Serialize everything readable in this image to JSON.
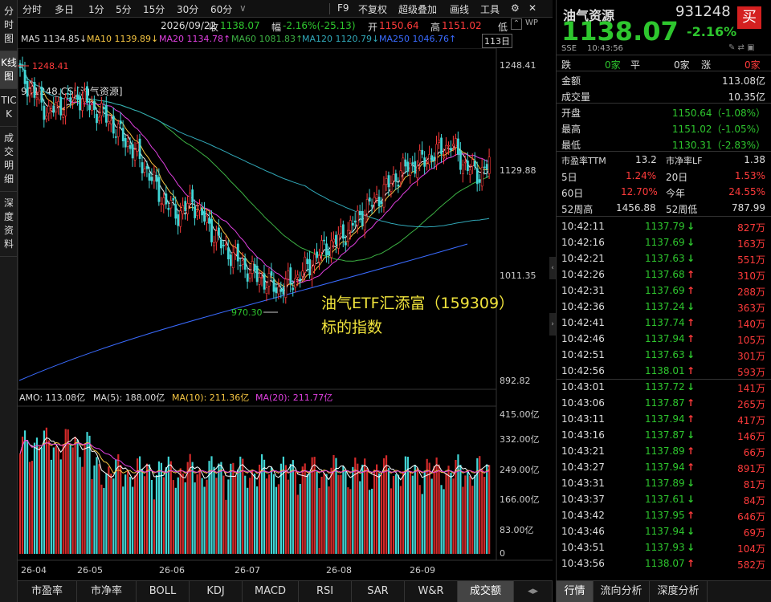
{
  "left_tabs": [
    "分时图",
    "K线图",
    "TICK",
    "成交明细",
    "深度资料"
  ],
  "toolbar": {
    "periods": [
      "分时",
      "多日",
      "1分",
      "5分",
      "15分",
      "30分",
      "60分"
    ],
    "right_items": [
      "F9",
      "不复权",
      "超级叠加",
      "画线",
      "工具"
    ],
    "info": {
      "date": "2026/09/22",
      "close_label": "收",
      "close": "1138.07",
      "chg_label": "幅",
      "chg": "-2.16%(-25.13)",
      "open_label": "开",
      "open": "1150.64",
      "high_label": "高",
      "high": "1151.02",
      "low_label": "低"
    }
  },
  "ma": {
    "ma5": "MA5 1134.85↓",
    "ma10": "MA10 1139.89↓",
    "ma20": "MA20 1134.78↑",
    "ma60": "MA60 1081.83↑",
    "ma120": "MA120 1120.79↓",
    "ma250": "MA250 1046.76↑",
    "days": "113日"
  },
  "chart": {
    "instrument": "931248.CSI[油气资源]",
    "price_axis": [
      "1248.41",
      "1129.88",
      "1011.35",
      "892.82"
    ],
    "high_mark": "1248.41",
    "low_mark": "970.30",
    "annotation_line1": "油气ETF汇添富（159309）",
    "annotation_line2": "标的指数",
    "vol_header": {
      "amo": "AMO: 113.08亿",
      "ma5": "MA(5): 188.00亿",
      "ma10": "MA(10): 211.36亿",
      "ma20": "MA(20): 211.77亿"
    },
    "vol_axis": [
      "415.00亿",
      "332.00亿",
      "249.00亿",
      "166.00亿",
      "83.00亿",
      "0"
    ],
    "months": [
      "26-04",
      "26-05",
      "26-06",
      "26-07",
      "26-08",
      "26-09"
    ]
  },
  "bottom_tabs": [
    "市盈率",
    "市净率",
    "BOLL",
    "KDJ",
    "MACD",
    "RSI",
    "SAR",
    "W&R",
    "成交额"
  ],
  "right": {
    "name": "油气资源",
    "code": "931248",
    "price": "1138.07",
    "change": "-2.16%",
    "buy": "买",
    "market": "SSE",
    "time": "10:43:56",
    "breadth": {
      "down_label": "跌",
      "down": "0家",
      "flat_label": "平",
      "flat": "0家",
      "up_label": "涨",
      "up": "0家"
    },
    "stats": [
      {
        "k": "金额",
        "v": "113.08亿"
      },
      {
        "k": "成交量",
        "v": "10.35亿"
      },
      {
        "k": "开盘",
        "v": "1150.64（-1.08%）"
      },
      {
        "k": "最高",
        "v": "1151.02（-1.05%）"
      },
      {
        "k": "最低",
        "v": "1130.31（-2.83%）"
      }
    ],
    "ratios": {
      "pe_label": "市盈率TTM",
      "pe": "13.2",
      "pb_label": "市净率LF",
      "pb": "1.38",
      "d5_label": "5日",
      "d5": "1.24%",
      "d20_label": "20日",
      "d20": "1.53%",
      "d60_label": "60日",
      "d60": "12.70%",
      "ytd_label": "今年",
      "ytd": "24.55%",
      "wh_label": "52周高",
      "wh": "1456.88",
      "wl_label": "52周低",
      "wl": "787.99"
    },
    "ticks": [
      {
        "t": "10:42:11",
        "p": "1137.79",
        "d": "down",
        "v": "827万"
      },
      {
        "t": "10:42:16",
        "p": "1137.69",
        "d": "down",
        "v": "163万"
      },
      {
        "t": "10:42:21",
        "p": "1137.63",
        "d": "down",
        "v": "551万"
      },
      {
        "t": "10:42:26",
        "p": "1137.68",
        "d": "up",
        "v": "310万"
      },
      {
        "t": "10:42:31",
        "p": "1137.69",
        "d": "up",
        "v": "288万"
      },
      {
        "t": "10:42:36",
        "p": "1137.24",
        "d": "down",
        "v": "363万"
      },
      {
        "t": "10:42:41",
        "p": "1137.74",
        "d": "up",
        "v": "140万"
      },
      {
        "t": "10:42:46",
        "p": "1137.94",
        "d": "up",
        "v": "105万"
      },
      {
        "t": "10:42:51",
        "p": "1137.63",
        "d": "down",
        "v": "301万"
      },
      {
        "t": "10:42:56",
        "p": "1138.01",
        "d": "up",
        "v": "593万"
      },
      {
        "t": "10:43:01",
        "p": "1137.72",
        "d": "down",
        "v": "141万"
      },
      {
        "t": "10:43:06",
        "p": "1137.87",
        "d": "up",
        "v": "265万"
      },
      {
        "t": "10:43:11",
        "p": "1137.94",
        "d": "up",
        "v": "417万"
      },
      {
        "t": "10:43:16",
        "p": "1137.87",
        "d": "down",
        "v": "146万"
      },
      {
        "t": "10:43:21",
        "p": "1137.89",
        "d": "up",
        "v": "66万"
      },
      {
        "t": "10:43:27",
        "p": "1137.94",
        "d": "up",
        "v": "891万"
      },
      {
        "t": "10:43:31",
        "p": "1137.89",
        "d": "down",
        "v": "81万"
      },
      {
        "t": "10:43:37",
        "p": "1137.61",
        "d": "down",
        "v": "84万"
      },
      {
        "t": "10:43:42",
        "p": "1137.95",
        "d": "up",
        "v": "646万"
      },
      {
        "t": "10:43:46",
        "p": "1137.94",
        "d": "down",
        "v": "69万"
      },
      {
        "t": "10:43:51",
        "p": "1137.93",
        "d": "down",
        "v": "104万"
      },
      {
        "t": "10:43:56",
        "p": "1138.07",
        "d": "up",
        "v": "582万"
      }
    ],
    "bottom_tabs": [
      "行情",
      "流向分析",
      "深度分析"
    ]
  },
  "colors": {
    "up": "#ff3b3b",
    "down": "#2ec62e",
    "cyan": "#41d6d6",
    "ma5": "#f0f0f0",
    "ma10": "#f5c542",
    "ma20": "#e040e0",
    "ma60": "#3cb043",
    "ma120": "#31a8b8",
    "ma250": "#3a6bff"
  }
}
